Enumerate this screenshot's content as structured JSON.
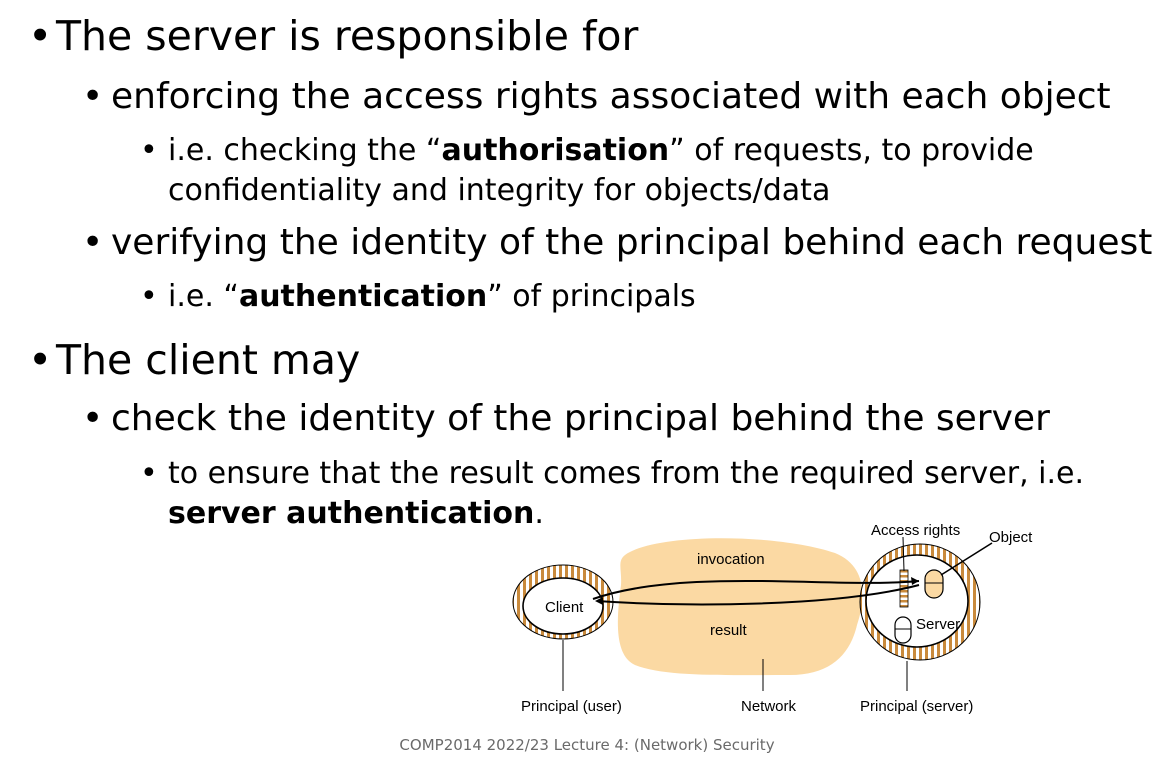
{
  "bullets": {
    "server": {
      "heading": "The server is responsible for",
      "access": "enforcing the access rights associated with each object",
      "authz_prefix": "i.e. checking the “",
      "authz_bold": "authorisation",
      "authz_suffix": "” of requests, to provide",
      "authz_line2": "confidentiality and integrity for objects/data",
      "verify": "verifying the identity of the principal behind each request",
      "authn_prefix": "i.e. “",
      "authn_bold": "authentication",
      "authn_suffix": "” of principals"
    },
    "client": {
      "heading": "The client may",
      "check": "check the identity of the principal behind the server",
      "ensure": "to ensure that the result comes from the required server, i.e.",
      "server_auth_bold": "server authentication",
      "server_auth_suffix": "."
    }
  },
  "diagram": {
    "access_rights": "Access rights",
    "object": "Object",
    "invocation": "invocation",
    "client": "Client",
    "result": "result",
    "server": "Server",
    "principal_user": "Principal (user)",
    "network": "Network",
    "principal_server": "Principal (server)",
    "colors": {
      "network": "#fbd9a3",
      "stripe": "#c98a3c"
    }
  },
  "footer": "COMP2014 2022/23 Lecture 4: (Network) Security"
}
